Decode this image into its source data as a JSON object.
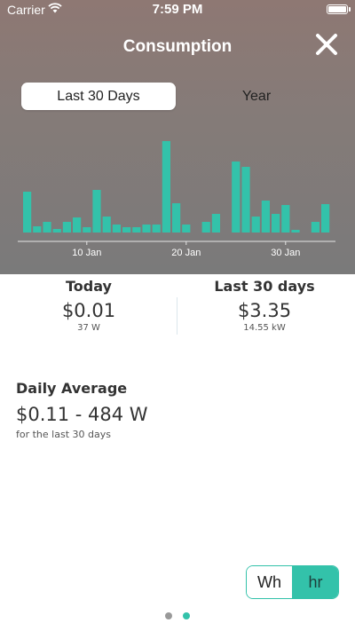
{
  "status_bar": {
    "carrier": "Carrier",
    "time": "7:59 PM",
    "icons": [
      "wifi-icon",
      "battery-icon"
    ]
  },
  "header": {
    "title": "Consumption",
    "close_icon": "close-icon"
  },
  "range_tabs": {
    "items": [
      {
        "label": "Last 30 Days",
        "selected": true
      },
      {
        "label": "Year",
        "selected": false
      }
    ]
  },
  "chart_data": {
    "type": "bar",
    "title": "",
    "xlabel": "",
    "ylabel": "",
    "bar_color": "#33c2aa",
    "x_ticks": [
      {
        "label": "10 Jan",
        "index": 6
      },
      {
        "label": "20 Jan",
        "index": 16
      },
      {
        "label": "30 Jan",
        "index": 26
      }
    ],
    "values": [
      46,
      7,
      12,
      4,
      12,
      17,
      6,
      48,
      18,
      9,
      6,
      6,
      9,
      9,
      103,
      33,
      9,
      0,
      12,
      21,
      0,
      80,
      74,
      18,
      36,
      21,
      31,
      3,
      0,
      12,
      32,
      0
    ]
  },
  "stats": {
    "today": {
      "title": "Today",
      "value": "$0.01",
      "sub": "37 W"
    },
    "last30": {
      "title": "Last 30 days",
      "value": "$3.35",
      "sub": "14.55 kW"
    }
  },
  "daily_average": {
    "title": "Daily Average",
    "value": "$0.11 - 484 W",
    "sub": "for the last 30 days"
  },
  "unit_toggle": {
    "options": [
      {
        "label": "Wh",
        "selected": false
      },
      {
        "label": "hr",
        "selected": true
      }
    ]
  },
  "pager": {
    "count": 2,
    "active_index": 1
  },
  "colors": {
    "accent": "#33c2aa",
    "header_top": "#8e7873",
    "header_bottom": "#7a7a7a"
  }
}
